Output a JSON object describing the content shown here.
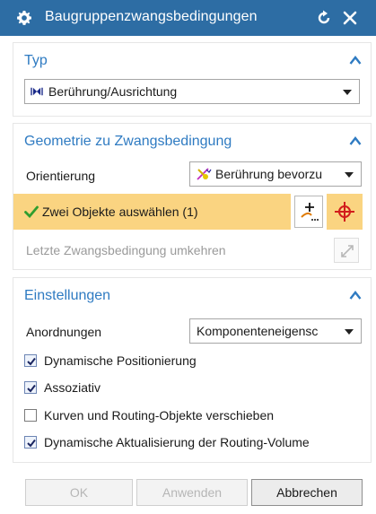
{
  "dialog": {
    "title": "Baugruppenzwangsbedingungen"
  },
  "icons": {
    "title": "gear-icon",
    "reset": "reset-icon",
    "close": "close-icon",
    "collapse": "chevron-up-icon"
  },
  "sections": {
    "typ": {
      "title": "Typ",
      "type_value": "Berührung/Ausrichtung"
    },
    "geometrie": {
      "title": "Geometrie zu Zwangsbedingung",
      "orientation_label": "Orientierung",
      "orientation_value": "Berührung bevorzu",
      "select_objects_label": "Zwei Objekte auswählen (1)",
      "reverse_label": "Letzte Zwangsbedingung umkehren"
    },
    "einstellungen": {
      "title": "Einstellungen",
      "arrangements_label": "Anordnungen",
      "arrangements_value": "Komponenteneigensc",
      "checkboxes": [
        {
          "label": "Dynamische Positionierung",
          "checked": true
        },
        {
          "label": "Assoziativ",
          "checked": true
        },
        {
          "label": "Kurven und Routing-Objekte verschieben",
          "checked": false
        },
        {
          "label": "Dynamische Aktualisierung der Routing-Volume",
          "checked": true
        }
      ]
    }
  },
  "buttons": {
    "ok": "OK",
    "apply": "Anwenden",
    "cancel": "Abbrechen"
  },
  "colors": {
    "titlebar": "#2d6da4",
    "section_title": "#2f7bc2",
    "selection_highlight": "#fad481"
  }
}
